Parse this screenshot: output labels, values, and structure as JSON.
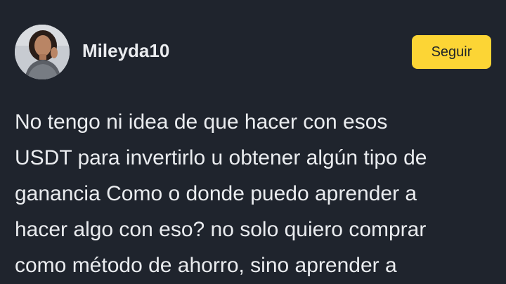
{
  "author": {
    "username": "Mileyda10",
    "avatar_icon": "user-avatar"
  },
  "follow_button": {
    "label": "Seguir",
    "color": "#fcd535"
  },
  "post": {
    "lines": [
      "No tengo ni idea de que hacer con esos",
      "USDT para invertirlo u obtener algún tipo de",
      "ganancia Como o donde puedo aprender a",
      "hacer algo con eso? no solo quiero comprar",
      "como método de ahorro, sino aprender a"
    ]
  },
  "theme": {
    "background": "#1f242d",
    "text": "#eaecef"
  }
}
